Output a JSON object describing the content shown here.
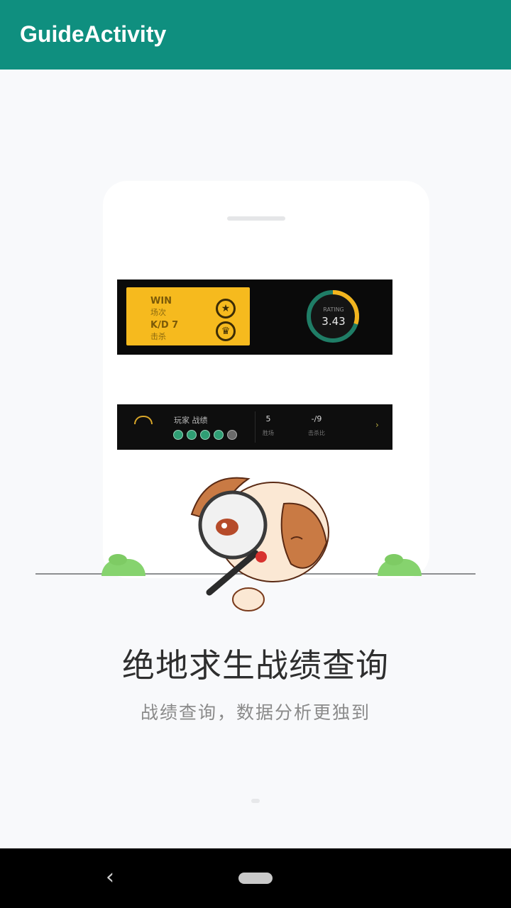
{
  "app_bar": {
    "title": "GuideActivity",
    "color": "#0f8f7f"
  },
  "guide": {
    "headline": "绝地求生战绩查询",
    "subline": "战绩查询，数据分析更独到"
  },
  "stat_card": {
    "row1_value": "WIN",
    "row1_label": "场次",
    "row2_value": "K/D 7",
    "row2_label": "击杀",
    "icon1": "medal-icon",
    "icon2": "trophy-icon",
    "gauge_label": "RATING",
    "gauge_value": "3.43",
    "gauge_fraction": 0.3
  },
  "player_card": {
    "name": "玩家 战绩",
    "stat1_value": "5",
    "stat1_label": "胜场",
    "stat2_value": "-/9",
    "stat2_label": "击杀比"
  },
  "nav_bar": {
    "back_icon": "back-icon",
    "home_icon": "home-pill-icon"
  }
}
